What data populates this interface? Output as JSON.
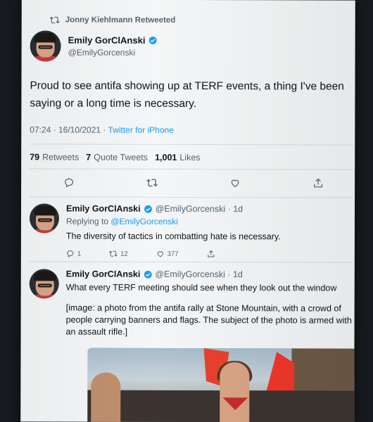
{
  "retweet_header": {
    "text": "Jonny Kiehlmann Retweeted"
  },
  "main_tweet": {
    "display_name": "Emily GorClAnski",
    "handle": "@EmilyGorcenski",
    "text_line1": "Proud to see antifa showing up at TERF events, a thing I've been",
    "text_line2": "saying or a long time is necessary.",
    "timestamp": "07:24 · 16/10/2021 · ",
    "source": "Twitter for iPhone",
    "stats": {
      "retweets_count": "79",
      "retweets_label": "Retweets",
      "quotes_count": "7",
      "quotes_label": "Quote Tweets",
      "likes_count": "1,001",
      "likes_label": "Likes"
    }
  },
  "replies": [
    {
      "display_name": "Emily GorClAnski",
      "handle_time": "@EmilyGorcenski · 1d",
      "replying_prefix": "Replying to",
      "replying_to": "@EmilyGorcenski",
      "text": "The diversity of tactics in combatting hate is necessary.",
      "reply_count": "1",
      "retweet_count": "12",
      "like_count": "377"
    },
    {
      "display_name": "Emily GorClAnski",
      "handle_time": "@EmilyGorcenski · 1d",
      "text": "What every TERF meeting should see when they look out the window",
      "image_desc": "[image: a photo from the antifa rally at Stone Mountain, with a crowd of people carrying banners and flags. The subject of the photo is armed with an assault rifle.]"
    }
  ],
  "colors": {
    "accent": "#1d9bf0",
    "muted": "#536471",
    "text": "#0f1419"
  },
  "icons": [
    "retweet-icon",
    "verified-badge-icon",
    "reply-icon",
    "like-icon",
    "share-icon"
  ]
}
